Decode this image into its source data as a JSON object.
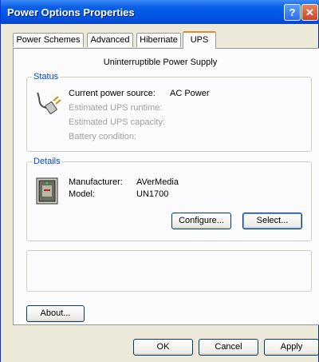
{
  "window": {
    "title": "Power Options Properties",
    "help_glyph": "?",
    "close_glyph": "✕"
  },
  "tabs": [
    {
      "label": "Power Schemes"
    },
    {
      "label": "Advanced"
    },
    {
      "label": "Hibernate"
    },
    {
      "label": "UPS",
      "active": true
    }
  ],
  "heading": "Uninterruptible Power Supply",
  "status": {
    "legend": "Status",
    "current_label": "Current power source:",
    "current_value": "AC Power",
    "runtime_label": "Estimated UPS runtime:",
    "capacity_label": "Estimated UPS capacity:",
    "battery_label": "Battery condition:",
    "icon": "power-plug-icon"
  },
  "details": {
    "legend": "Details",
    "manufacturer_label": "Manufacturer:",
    "manufacturer_value": "AVerMedia",
    "model_label": "Model:",
    "model_value": "UN1700",
    "icon": "ups-device-icon",
    "configure_label": "Configure...",
    "select_label": "Select..."
  },
  "about_label": "About...",
  "footer": {
    "ok": "OK",
    "cancel": "Cancel",
    "apply": "Apply"
  },
  "colors": {
    "titlebar": "#0055e5",
    "legend": "#0046d5",
    "dialog_bg": "#ece9d8",
    "tab_accent": "#e68b2c"
  }
}
